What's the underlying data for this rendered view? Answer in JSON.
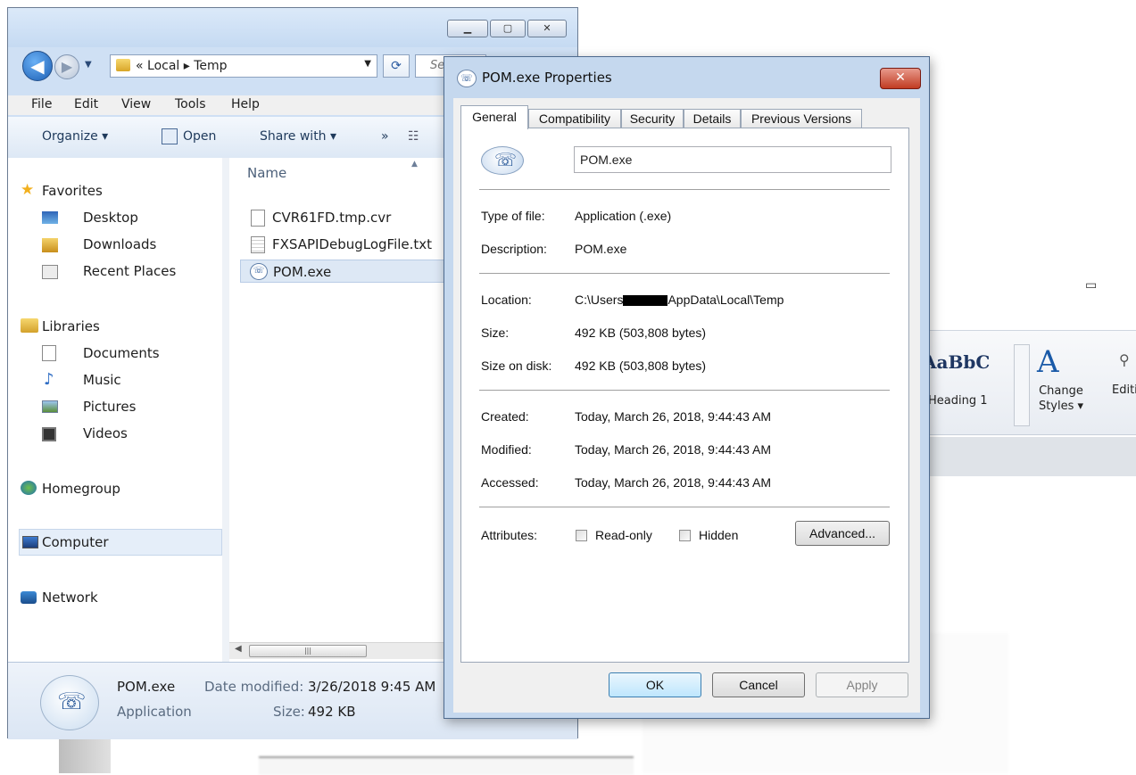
{
  "explorer": {
    "address": {
      "crumbs": "« Local  ▸  Temp"
    },
    "search_placeholder": "Se",
    "menu": [
      "File",
      "Edit",
      "View",
      "Tools",
      "Help"
    ],
    "commands": {
      "organize": "Organize ▾",
      "open": "Open",
      "share": "Share with ▾",
      "more": "»"
    },
    "nav": {
      "favorites": "Favorites",
      "desktop": "Desktop",
      "downloads": "Downloads",
      "recent": "Recent Places",
      "libraries": "Libraries",
      "documents": "Documents",
      "music": "Music",
      "pictures": "Pictures",
      "videos": "Videos",
      "homegroup": "Homegroup",
      "computer": "Computer",
      "network": "Network"
    },
    "column_name": "Name",
    "files": [
      "CVR61FD.tmp.cvr",
      "FXSAPIDebugLogFile.txt",
      "POM.exe"
    ],
    "details": {
      "name": "POM.exe",
      "type": "Application",
      "date_label": "Date modified:",
      "date_value": "3/26/2018 9:45 AM",
      "size_label": "Size:",
      "size_value": "492 KB"
    }
  },
  "properties": {
    "title": "POM.exe Properties",
    "tabs": [
      "General",
      "Compatibility",
      "Security",
      "Details",
      "Previous Versions"
    ],
    "file_name": "POM.exe",
    "rows": {
      "type_label": "Type of file:",
      "type_value": "Application (.exe)",
      "desc_label": "Description:",
      "desc_value": "POM.exe",
      "loc_label": "Location:",
      "loc_value_a": "C:\\Users",
      "loc_value_b": "AppData\\Local\\Temp",
      "size_label": "Size:",
      "size_value": "492 KB (503,808 bytes)",
      "disk_label": "Size on disk:",
      "disk_value": "492 KB (503,808 bytes)",
      "created_label": "Created:",
      "created_value": "Today, March 26, 2018, 9:44:43 AM",
      "modified_label": "Modified:",
      "modified_value": "Today, March 26, 2018, 9:44:43 AM",
      "accessed_label": "Accessed:",
      "accessed_value": "Today, March 26, 2018, 9:44:43 AM",
      "attr_label": "Attributes:",
      "readonly": "Read-only",
      "hidden": "Hidden",
      "advanced": "Advanced..."
    },
    "buttons": {
      "ok": "OK",
      "cancel": "Cancel",
      "apply": "Apply"
    }
  },
  "background_word": {
    "style_sample": "AaBbC",
    "heading": "Heading 1",
    "change_styles": "Change Styles ▾",
    "editing": "Editir"
  }
}
